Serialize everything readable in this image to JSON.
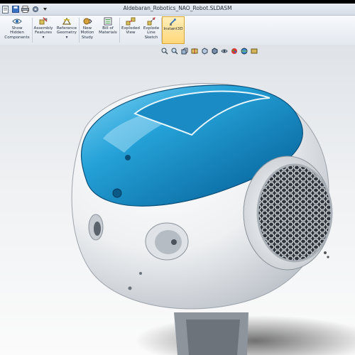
{
  "window": {
    "title": "Aldebaran_Robotics_NAO_Robot.SLDASM"
  },
  "quick_access": {
    "icons": [
      "document-icon",
      "save-icon",
      "print-icon",
      "options-icon"
    ]
  },
  "ribbon": {
    "buttons": [
      {
        "id": "show-hidden",
        "label": "Show\nHidden\nComponents",
        "icon": "eye-icon"
      },
      {
        "id": "assembly-features",
        "label": "Assembly\nFeatures\n▾",
        "icon": "assembly-features-icon"
      },
      {
        "id": "reference-geometry",
        "label": "Reference\nGeometry\n▾",
        "icon": "reference-geometry-icon"
      },
      {
        "id": "new-motion-study",
        "label": "New\nMotion\nStudy",
        "icon": "motion-study-icon"
      },
      {
        "id": "bill-of-materials",
        "label": "Bill of\nMaterials",
        "icon": "bom-icon"
      },
      {
        "id": "exploded-view",
        "label": "Exploded\nView",
        "icon": "exploded-view-icon"
      },
      {
        "id": "explode-line-sketch",
        "label": "Explode\nLine\nSketch",
        "icon": "explode-line-icon"
      },
      {
        "id": "instant3d",
        "label": "Instant3D",
        "icon": "instant3d-icon",
        "active": true
      }
    ]
  },
  "view_toolbar": {
    "icons": [
      "zoom-fit-icon",
      "zoom-area-icon",
      "previous-view-icon",
      "section-view-icon",
      "view-orientation-icon",
      "display-style-icon",
      "hide-show-icon",
      "appearance-icon",
      "scene-icon",
      "view-settings-icon"
    ]
  },
  "colors": {
    "head_blue": "#1f8fc4",
    "body_white": "#f4f5f6",
    "active_button": "#ffd77a"
  }
}
